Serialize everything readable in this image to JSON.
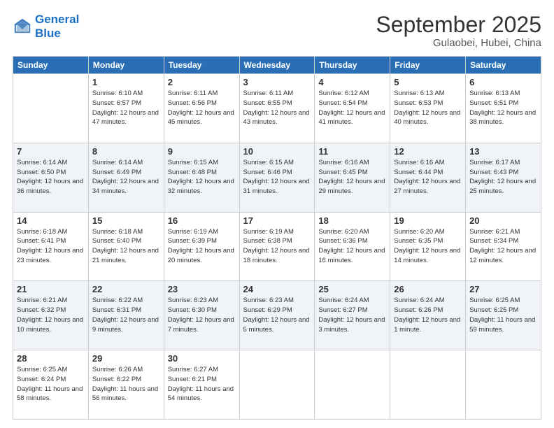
{
  "header": {
    "logo_line1": "General",
    "logo_line2": "Blue",
    "month": "September 2025",
    "location": "Gulaobei, Hubei, China"
  },
  "weekdays": [
    "Sunday",
    "Monday",
    "Tuesday",
    "Wednesday",
    "Thursday",
    "Friday",
    "Saturday"
  ],
  "weeks": [
    [
      {
        "day": "",
        "sunrise": "",
        "sunset": "",
        "daylight": ""
      },
      {
        "day": "1",
        "sunrise": "Sunrise: 6:10 AM",
        "sunset": "Sunset: 6:57 PM",
        "daylight": "Daylight: 12 hours and 47 minutes."
      },
      {
        "day": "2",
        "sunrise": "Sunrise: 6:11 AM",
        "sunset": "Sunset: 6:56 PM",
        "daylight": "Daylight: 12 hours and 45 minutes."
      },
      {
        "day": "3",
        "sunrise": "Sunrise: 6:11 AM",
        "sunset": "Sunset: 6:55 PM",
        "daylight": "Daylight: 12 hours and 43 minutes."
      },
      {
        "day": "4",
        "sunrise": "Sunrise: 6:12 AM",
        "sunset": "Sunset: 6:54 PM",
        "daylight": "Daylight: 12 hours and 41 minutes."
      },
      {
        "day": "5",
        "sunrise": "Sunrise: 6:13 AM",
        "sunset": "Sunset: 6:53 PM",
        "daylight": "Daylight: 12 hours and 40 minutes."
      },
      {
        "day": "6",
        "sunrise": "Sunrise: 6:13 AM",
        "sunset": "Sunset: 6:51 PM",
        "daylight": "Daylight: 12 hours and 38 minutes."
      }
    ],
    [
      {
        "day": "7",
        "sunrise": "Sunrise: 6:14 AM",
        "sunset": "Sunset: 6:50 PM",
        "daylight": "Daylight: 12 hours and 36 minutes."
      },
      {
        "day": "8",
        "sunrise": "Sunrise: 6:14 AM",
        "sunset": "Sunset: 6:49 PM",
        "daylight": "Daylight: 12 hours and 34 minutes."
      },
      {
        "day": "9",
        "sunrise": "Sunrise: 6:15 AM",
        "sunset": "Sunset: 6:48 PM",
        "daylight": "Daylight: 12 hours and 32 minutes."
      },
      {
        "day": "10",
        "sunrise": "Sunrise: 6:15 AM",
        "sunset": "Sunset: 6:46 PM",
        "daylight": "Daylight: 12 hours and 31 minutes."
      },
      {
        "day": "11",
        "sunrise": "Sunrise: 6:16 AM",
        "sunset": "Sunset: 6:45 PM",
        "daylight": "Daylight: 12 hours and 29 minutes."
      },
      {
        "day": "12",
        "sunrise": "Sunrise: 6:16 AM",
        "sunset": "Sunset: 6:44 PM",
        "daylight": "Daylight: 12 hours and 27 minutes."
      },
      {
        "day": "13",
        "sunrise": "Sunrise: 6:17 AM",
        "sunset": "Sunset: 6:43 PM",
        "daylight": "Daylight: 12 hours and 25 minutes."
      }
    ],
    [
      {
        "day": "14",
        "sunrise": "Sunrise: 6:18 AM",
        "sunset": "Sunset: 6:41 PM",
        "daylight": "Daylight: 12 hours and 23 minutes."
      },
      {
        "day": "15",
        "sunrise": "Sunrise: 6:18 AM",
        "sunset": "Sunset: 6:40 PM",
        "daylight": "Daylight: 12 hours and 21 minutes."
      },
      {
        "day": "16",
        "sunrise": "Sunrise: 6:19 AM",
        "sunset": "Sunset: 6:39 PM",
        "daylight": "Daylight: 12 hours and 20 minutes."
      },
      {
        "day": "17",
        "sunrise": "Sunrise: 6:19 AM",
        "sunset": "Sunset: 6:38 PM",
        "daylight": "Daylight: 12 hours and 18 minutes."
      },
      {
        "day": "18",
        "sunrise": "Sunrise: 6:20 AM",
        "sunset": "Sunset: 6:36 PM",
        "daylight": "Daylight: 12 hours and 16 minutes."
      },
      {
        "day": "19",
        "sunrise": "Sunrise: 6:20 AM",
        "sunset": "Sunset: 6:35 PM",
        "daylight": "Daylight: 12 hours and 14 minutes."
      },
      {
        "day": "20",
        "sunrise": "Sunrise: 6:21 AM",
        "sunset": "Sunset: 6:34 PM",
        "daylight": "Daylight: 12 hours and 12 minutes."
      }
    ],
    [
      {
        "day": "21",
        "sunrise": "Sunrise: 6:21 AM",
        "sunset": "Sunset: 6:32 PM",
        "daylight": "Daylight: 12 hours and 10 minutes."
      },
      {
        "day": "22",
        "sunrise": "Sunrise: 6:22 AM",
        "sunset": "Sunset: 6:31 PM",
        "daylight": "Daylight: 12 hours and 9 minutes."
      },
      {
        "day": "23",
        "sunrise": "Sunrise: 6:23 AM",
        "sunset": "Sunset: 6:30 PM",
        "daylight": "Daylight: 12 hours and 7 minutes."
      },
      {
        "day": "24",
        "sunrise": "Sunrise: 6:23 AM",
        "sunset": "Sunset: 6:29 PM",
        "daylight": "Daylight: 12 hours and 5 minutes."
      },
      {
        "day": "25",
        "sunrise": "Sunrise: 6:24 AM",
        "sunset": "Sunset: 6:27 PM",
        "daylight": "Daylight: 12 hours and 3 minutes."
      },
      {
        "day": "26",
        "sunrise": "Sunrise: 6:24 AM",
        "sunset": "Sunset: 6:26 PM",
        "daylight": "Daylight: 12 hours and 1 minute."
      },
      {
        "day": "27",
        "sunrise": "Sunrise: 6:25 AM",
        "sunset": "Sunset: 6:25 PM",
        "daylight": "Daylight: 11 hours and 59 minutes."
      }
    ],
    [
      {
        "day": "28",
        "sunrise": "Sunrise: 6:25 AM",
        "sunset": "Sunset: 6:24 PM",
        "daylight": "Daylight: 11 hours and 58 minutes."
      },
      {
        "day": "29",
        "sunrise": "Sunrise: 6:26 AM",
        "sunset": "Sunset: 6:22 PM",
        "daylight": "Daylight: 11 hours and 56 minutes."
      },
      {
        "day": "30",
        "sunrise": "Sunrise: 6:27 AM",
        "sunset": "Sunset: 6:21 PM",
        "daylight": "Daylight: 11 hours and 54 minutes."
      },
      {
        "day": "",
        "sunrise": "",
        "sunset": "",
        "daylight": ""
      },
      {
        "day": "",
        "sunrise": "",
        "sunset": "",
        "daylight": ""
      },
      {
        "day": "",
        "sunrise": "",
        "sunset": "",
        "daylight": ""
      },
      {
        "day": "",
        "sunrise": "",
        "sunset": "",
        "daylight": ""
      }
    ]
  ]
}
